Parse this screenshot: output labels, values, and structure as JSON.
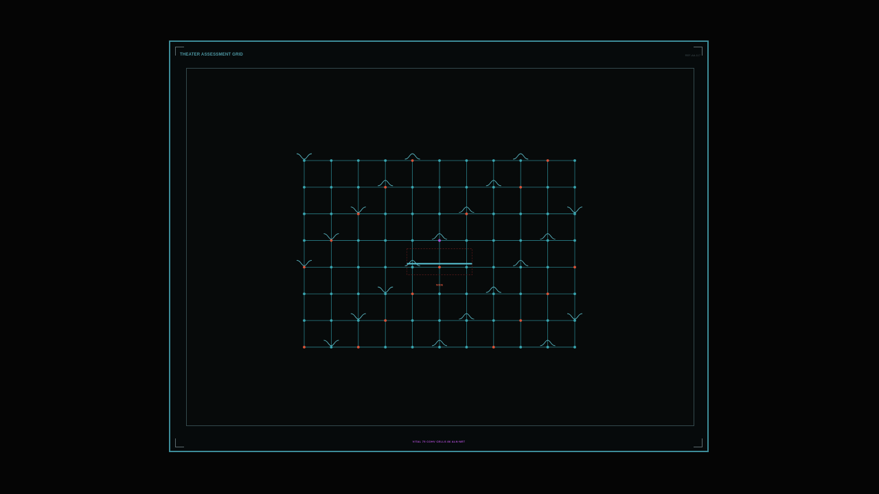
{
  "header": {
    "title": "THEATER ASSESSMENT GRID",
    "ref": "REF-AA-117"
  },
  "footer": {
    "status": "VITAL 75 COHV CELLS 86 ALN·NET"
  },
  "grid": {
    "columns": 11,
    "rows": 8,
    "center_label": "NODE",
    "colors": {
      "frame": "#3d8b98",
      "line": "#2a7f88",
      "node": "#3aa5b0",
      "alert": "#d8543a",
      "focus": "#b24ed8",
      "wave": "#5ab8c4",
      "bar": "#5ac6d8"
    },
    "alert_nodes": [
      [
        0,
        4
      ],
      [
        0,
        7
      ],
      [
        1,
        3
      ],
      [
        3,
        1
      ],
      [
        4,
        0
      ],
      [
        8,
        1
      ],
      [
        9,
        0
      ],
      [
        5,
        3
      ],
      [
        6,
        2
      ],
      [
        10,
        4
      ],
      [
        4,
        5
      ],
      [
        9,
        5
      ],
      [
        3,
        6
      ],
      [
        8,
        6
      ],
      [
        2,
        7
      ],
      [
        7,
        7
      ],
      [
        2,
        2
      ],
      [
        5,
        4
      ]
    ],
    "focus_nodes": [
      [
        5,
        3
      ]
    ],
    "waves": [
      {
        "c": 0,
        "r": 0,
        "shape": "down"
      },
      {
        "c": 4,
        "r": 0,
        "shape": "up"
      },
      {
        "c": 8,
        "r": 0,
        "shape": "up"
      },
      {
        "c": 3,
        "r": 1,
        "shape": "up"
      },
      {
        "c": 7,
        "r": 1,
        "shape": "up"
      },
      {
        "c": 2,
        "r": 2,
        "shape": "down"
      },
      {
        "c": 6,
        "r": 2,
        "shape": "up"
      },
      {
        "c": 10,
        "r": 2,
        "shape": "down"
      },
      {
        "c": 1,
        "r": 3,
        "shape": "down"
      },
      {
        "c": 5,
        "r": 3,
        "shape": "up"
      },
      {
        "c": 9,
        "r": 3,
        "shape": "up"
      },
      {
        "c": 0,
        "r": 4,
        "shape": "down"
      },
      {
        "c": 4,
        "r": 4,
        "shape": "up"
      },
      {
        "c": 8,
        "r": 4,
        "shape": "up"
      },
      {
        "c": 3,
        "r": 5,
        "shape": "down"
      },
      {
        "c": 7,
        "r": 5,
        "shape": "up"
      },
      {
        "c": 2,
        "r": 6,
        "shape": "down"
      },
      {
        "c": 6,
        "r": 6,
        "shape": "up"
      },
      {
        "c": 10,
        "r": 6,
        "shape": "down"
      },
      {
        "c": 1,
        "r": 7,
        "shape": "down"
      },
      {
        "c": 5,
        "r": 7,
        "shape": "up"
      },
      {
        "c": 9,
        "r": 7,
        "shape": "up"
      }
    ]
  }
}
